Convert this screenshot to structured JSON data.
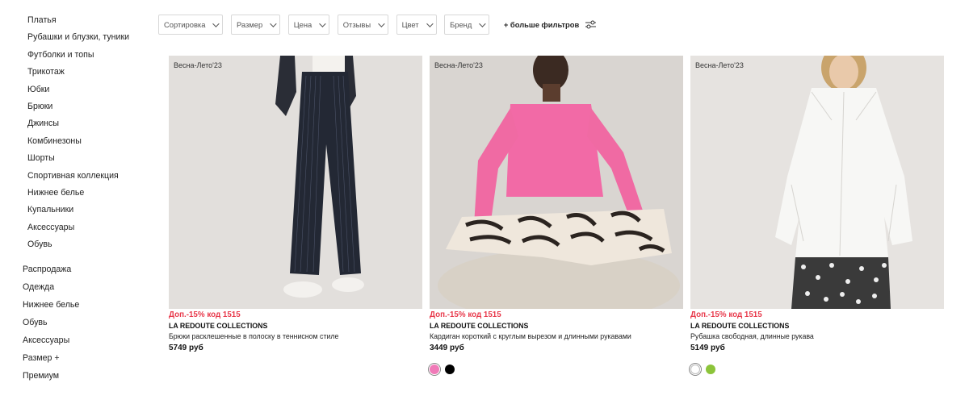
{
  "sidebar": {
    "sub_items": [
      {
        "label": "Платья"
      },
      {
        "label": "Рубашки и блузки, туники"
      },
      {
        "label": "Футболки и топы"
      },
      {
        "label": "Трикотаж"
      },
      {
        "label": "Юбки"
      },
      {
        "label": "Брюки"
      },
      {
        "label": "Джинсы"
      },
      {
        "label": "Комбинезоны"
      },
      {
        "label": "Шорты"
      },
      {
        "label": "Спортивная коллекция"
      },
      {
        "label": "Нижнее белье"
      },
      {
        "label": "Купальники"
      },
      {
        "label": "Аксессуары"
      },
      {
        "label": "Обувь"
      }
    ],
    "main_items": [
      {
        "label": "Распродажа"
      },
      {
        "label": "Одежда"
      },
      {
        "label": "Нижнее белье"
      },
      {
        "label": "Обувь"
      },
      {
        "label": "Аксессуары"
      },
      {
        "label": "Размер +"
      },
      {
        "label": "Премиум"
      }
    ]
  },
  "filters": {
    "items": [
      {
        "label": "Сортировка"
      },
      {
        "label": "Размер"
      },
      {
        "label": "Цена"
      },
      {
        "label": "Отзывы"
      },
      {
        "label": "Цвет"
      },
      {
        "label": "Бренд"
      }
    ],
    "more_label": "+ больше фильтров",
    "more_icon": "sliders-icon"
  },
  "products": [
    {
      "season": "Весна-Лето'23",
      "promo": "Доп.-15% код 1515",
      "brand": "LA REDOUTE COLLECTIONS",
      "name": "Брюки расклешенные в полоску в теннисном стиле",
      "price": "5749 руб",
      "swatches": []
    },
    {
      "season": "Весна-Лето'23",
      "promo": "Доп.-15% код 1515",
      "brand": "LA REDOUTE COLLECTIONS",
      "name": "Кардиган короткий с круглым вырезом и длинными рукавами",
      "price": "3449 руб",
      "swatches": [
        {
          "color": "#f07ab8",
          "selected": true
        },
        {
          "color": "#000000",
          "selected": false
        }
      ]
    },
    {
      "season": "Весна-Лето'23",
      "promo": "Доп.-15% код 1515",
      "brand": "LA REDOUTE COLLECTIONS",
      "name": "Рубашка свободная, длинные рукава",
      "price": "5149 руб",
      "swatches": [
        {
          "color": "#ffffff",
          "selected": true
        },
        {
          "color": "#8cc43a",
          "selected": false
        }
      ]
    }
  ],
  "colors": {
    "promo": "#e8394b",
    "photo_bg": "#e4e1de"
  }
}
